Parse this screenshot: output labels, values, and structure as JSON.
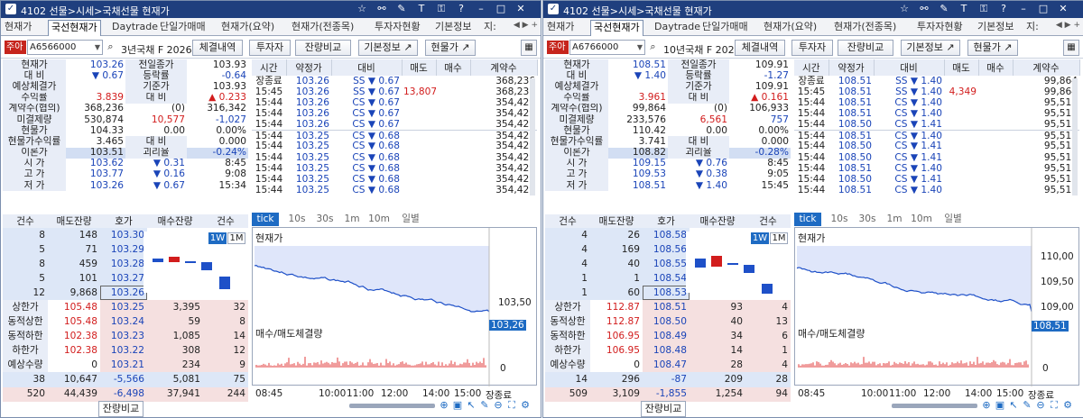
{
  "windows": [
    {
      "title": "4102 선물>시세>국채선물 현재가",
      "tabs": [
        "현재가",
        "국선현재가",
        "Daytrade",
        "단일가매매",
        "현재가(요약)",
        "현재가(전종목)",
        "투자자현황",
        "기본정보",
        "지:"
      ],
      "active_tab": 1,
      "badge": "주아",
      "code": "A6566000",
      "product_name": "3년국채 F 202606",
      "buttons": [
        "체결내역",
        "투자자",
        "잔량비교",
        "기본정보 ↗",
        "현물가 ↗"
      ],
      "quote_rows": [
        [
          "현재가",
          "103.26",
          "전일종가",
          "103.93"
        ],
        [
          "대  비",
          "▼ 0.67",
          "등락률",
          "-0.64"
        ],
        [
          "예상체결가",
          "",
          "기준가",
          "103.93"
        ],
        [
          "수익률",
          "3.839",
          "대  비",
          "▲ 0.233"
        ],
        [
          "계약수(협의)",
          "368,236",
          "(0)",
          "316,342"
        ],
        [
          "미결제량",
          "530,874",
          "10,577",
          "-1,027"
        ],
        [
          "현물가",
          "104.33",
          "0.00",
          "0.00%"
        ],
        [
          "현물가수익률",
          "3.465",
          "대  비",
          "0.000"
        ],
        [
          "이론가",
          "103.51",
          "괴리율",
          "-0.24%"
        ],
        [
          "시   가",
          "103.62",
          "▼ 0.31",
          "8:45"
        ],
        [
          "고   가",
          "103.77",
          "▼ 0.16",
          "9:08"
        ],
        [
          "저   가",
          "103.26",
          "▼ 0.67",
          "15:34"
        ]
      ],
      "quote_colors": [
        "blue",
        "blue",
        "",
        "red",
        "",
        "",
        "",
        "",
        "",
        "blue",
        "blue",
        "blue"
      ],
      "ticks_header": [
        "시간",
        "약정가",
        "대비",
        "매도",
        "매수",
        "계약수"
      ],
      "ticks": [
        [
          "장종료",
          "103.26",
          "SS ▼ 0.67",
          "",
          "",
          "368,236"
        ],
        [
          "15:45",
          "103.26",
          "SS ▼ 0.67",
          "13,807",
          "",
          "368,236"
        ],
        [
          "15:44",
          "103.26",
          "CS ▼ 0.67",
          "",
          "",
          "354,429"
        ],
        [
          "15:44",
          "103.26",
          "CS ▼ 0.67",
          "",
          "",
          "354,429"
        ],
        [
          "15:44",
          "103.26",
          "CS ▼ 0.67",
          "",
          "",
          "354,429"
        ],
        [
          "15:44",
          "103.25",
          "CS ▼ 0.68",
          "",
          "",
          "354,429"
        ],
        [
          "15:44",
          "103.25",
          "CS ▼ 0.68",
          "",
          "",
          "354,429"
        ],
        [
          "15:44",
          "103.25",
          "CS ▼ 0.68",
          "",
          "",
          "354,429"
        ],
        [
          "15:44",
          "103.25",
          "CS ▼ 0.68",
          "",
          "",
          "354,429"
        ],
        [
          "15:44",
          "103.25",
          "CS ▼ 0.68",
          "",
          "",
          "354,429"
        ],
        [
          "15:44",
          "103.25",
          "CS ▼ 0.68",
          "",
          "",
          "354,429"
        ]
      ],
      "ob_header": [
        "건수",
        "매도잔량",
        "호가",
        "매수잔량",
        "건수"
      ],
      "asks": [
        [
          "8",
          "148",
          "103.30"
        ],
        [
          "5",
          "71",
          "103.29"
        ],
        [
          "8",
          "459",
          "103.28"
        ],
        [
          "5",
          "101",
          "103.27"
        ],
        [
          "12",
          "9,868",
          "103.26"
        ]
      ],
      "bids": [
        [
          "103.25",
          "3,395",
          "32"
        ],
        [
          "103.24",
          "59",
          "8"
        ],
        [
          "103.23",
          "1,085",
          "14"
        ],
        [
          "103.22",
          "308",
          "12"
        ],
        [
          "103.21",
          "234",
          "9"
        ]
      ],
      "side_rows": [
        [
          "상한가",
          "105.48"
        ],
        [
          "동적상한",
          "105.48"
        ],
        [
          "동적하한",
          "102.38"
        ],
        [
          "하한가",
          "102.38"
        ],
        [
          "예상수량",
          "0"
        ]
      ],
      "totals": [
        [
          "38",
          "10,647",
          "-5,566",
          "5,081",
          "75"
        ],
        [
          "520",
          "44,439",
          "-6,498",
          "37,941",
          "244"
        ]
      ],
      "bottom_label": "잔량비교",
      "chart_tabs": [
        "tick",
        "10s",
        "30s",
        "1m",
        "10m",
        "일별"
      ],
      "chart_title": "현재가",
      "vol_title": "매수/매도체결량",
      "price_axis": [
        "103,50",
        "103,26"
      ],
      "vol_axis": "0",
      "time_axis": [
        "08:45",
        "10:00",
        "11:00",
        "12:00",
        "14:00",
        "15:00",
        "장종료"
      ],
      "range_buttons": [
        "1W",
        "1M"
      ]
    },
    {
      "title": "4102 선물>시세>국채선물 현재가",
      "tabs": [
        "현재가",
        "국선현재가",
        "Daytrade",
        "단일가매매",
        "현재가(요약)",
        "현재가(전종목)",
        "투자자현황",
        "기본정보",
        "지:"
      ],
      "active_tab": 1,
      "badge": "주아",
      "code": "A6766000",
      "product_name": "10년국채 F 202606",
      "buttons": [
        "체결내역",
        "투자자",
        "잔량비교",
        "기본정보 ↗",
        "현물가 ↗"
      ],
      "quote_rows": [
        [
          "현재가",
          "108.51",
          "전일종가",
          "109.91"
        ],
        [
          "대  비",
          "▼ 1.40",
          "등락률",
          "-1.27"
        ],
        [
          "예상체결가",
          "",
          "기준가",
          "109.91"
        ],
        [
          "수익률",
          "3.961",
          "대  비",
          "▲ 0.161"
        ],
        [
          "계약수(협의)",
          "99,864",
          "(0)",
          "106,933"
        ],
        [
          "미결제량",
          "233,576",
          "6,561",
          "757"
        ],
        [
          "현물가",
          "110.42",
          "0.00",
          "0.00%"
        ],
        [
          "현물가수익률",
          "3.741",
          "대  비",
          "0.000"
        ],
        [
          "이론가",
          "108.82",
          "괴리율",
          "-0.28%"
        ],
        [
          "시   가",
          "109.15",
          "▼ 0.76",
          "8:45"
        ],
        [
          "고   가",
          "109.53",
          "▼ 0.38",
          "9:05"
        ],
        [
          "저   가",
          "108.51",
          "▼ 1.40",
          "15:45"
        ]
      ],
      "quote_colors": [
        "blue",
        "blue",
        "",
        "red",
        "",
        "",
        "",
        "",
        "",
        "blue",
        "blue",
        "blue"
      ],
      "ticks_header": [
        "시간",
        "약정가",
        "대비",
        "매도",
        "매수",
        "계약수"
      ],
      "ticks": [
        [
          "장종료",
          "108.51",
          "SS ▼ 1.40",
          "",
          "",
          "99,864"
        ],
        [
          "15:45",
          "108.51",
          "SS ▼ 1.40",
          "4,349",
          "",
          "99,864"
        ],
        [
          "15:44",
          "108.51",
          "CS ▼ 1.40",
          "",
          "",
          "95,515"
        ],
        [
          "15:44",
          "108.51",
          "CS ▼ 1.40",
          "",
          "",
          "95,515"
        ],
        [
          "15:44",
          "108.50",
          "CS ▼ 1.41",
          "",
          "",
          "95,515"
        ],
        [
          "15:44",
          "108.51",
          "CS ▼ 1.40",
          "",
          "",
          "95,515"
        ],
        [
          "15:44",
          "108.50",
          "CS ▼ 1.41",
          "",
          "",
          "95,515"
        ],
        [
          "15:44",
          "108.50",
          "CS ▼ 1.41",
          "",
          "",
          "95,515"
        ],
        [
          "15:44",
          "108.51",
          "CS ▼ 1.40",
          "",
          "",
          "95,515"
        ],
        [
          "15:44",
          "108.50",
          "CS ▼ 1.41",
          "",
          "",
          "95,515"
        ],
        [
          "15:44",
          "108.51",
          "CS ▼ 1.40",
          "",
          "",
          "95,515"
        ]
      ],
      "ob_header": [
        "건수",
        "매도잔량",
        "호가",
        "매수잔량",
        "건수"
      ],
      "asks": [
        [
          "4",
          "26",
          "108.58"
        ],
        [
          "4",
          "169",
          "108.56"
        ],
        [
          "4",
          "40",
          "108.55"
        ],
        [
          "1",
          "1",
          "108.54"
        ],
        [
          "1",
          "60",
          "108.53"
        ]
      ],
      "bids": [
        [
          "108.51",
          "93",
          "4"
        ],
        [
          "108.50",
          "40",
          "13"
        ],
        [
          "108.49",
          "34",
          "6"
        ],
        [
          "108.48",
          "14",
          "1"
        ],
        [
          "108.47",
          "28",
          "4"
        ]
      ],
      "side_rows": [
        [
          "상한가",
          "112.87"
        ],
        [
          "동적상한",
          "112.87"
        ],
        [
          "동적하한",
          "106.95"
        ],
        [
          "하한가",
          "106.95"
        ],
        [
          "예상수량",
          "0"
        ]
      ],
      "totals": [
        [
          "14",
          "296",
          "-87",
          "209",
          "28"
        ],
        [
          "509",
          "3,109",
          "-1,855",
          "1,254",
          "94"
        ]
      ],
      "bottom_label": "잔량비교",
      "chart_tabs": [
        "tick",
        "10s",
        "30s",
        "1m",
        "10m",
        "일별"
      ],
      "chart_title": "현재가",
      "vol_title": "매수/매도체결량",
      "price_axis": [
        "110,00",
        "109,50",
        "109,00",
        "108,51"
      ],
      "vol_axis": "0",
      "time_axis": [
        "08:45",
        "10:00",
        "11:00",
        "12:00",
        "14:00",
        "15:00",
        "장종료"
      ],
      "range_buttons": [
        "1W",
        "1M"
      ]
    }
  ],
  "colors": {
    "title_bar": "#1f3f7e",
    "up": "#d21d1d",
    "down": "#1a44b8",
    "accent": "#1e6bc3",
    "price_line": "#1e50c8",
    "volume": "#e23a3a"
  }
}
